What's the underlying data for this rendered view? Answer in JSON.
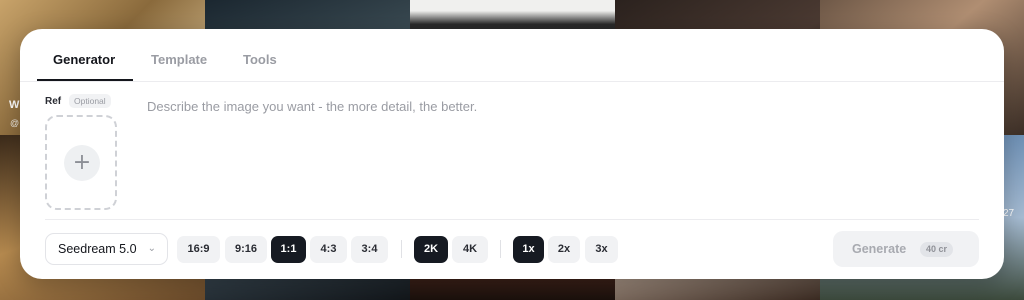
{
  "background": {
    "overlay_text_1": "W",
    "overlay_text_2": "@",
    "overlay_text_3": "27"
  },
  "tabs": [
    {
      "label": "Generator",
      "active": true
    },
    {
      "label": "Template",
      "active": false
    },
    {
      "label": "Tools",
      "active": false
    }
  ],
  "ref": {
    "label": "Ref",
    "optional": "Optional",
    "add_icon": "plus-icon"
  },
  "prompt": {
    "placeholder": "Describe the image you want - the more detail, the better.",
    "value": ""
  },
  "model": {
    "selected": "Seedream 5.0",
    "icon": "chevron-down-icon"
  },
  "aspect_ratios": [
    {
      "label": "16:9",
      "selected": false
    },
    {
      "label": "9:16",
      "selected": false
    },
    {
      "label": "1:1",
      "selected": true
    },
    {
      "label": "4:3",
      "selected": false
    },
    {
      "label": "3:4",
      "selected": false
    }
  ],
  "resolutions": [
    {
      "label": "2K",
      "selected": true
    },
    {
      "label": "4K",
      "selected": false
    }
  ],
  "counts": [
    {
      "label": "1x",
      "selected": true
    },
    {
      "label": "2x",
      "selected": false
    },
    {
      "label": "3x",
      "selected": false
    }
  ],
  "generate": {
    "label": "Generate",
    "cost": "40 cr"
  },
  "colors": {
    "selected_chip": "#161a22",
    "chip": "#f1f2f4",
    "panel": "#ffffff"
  }
}
